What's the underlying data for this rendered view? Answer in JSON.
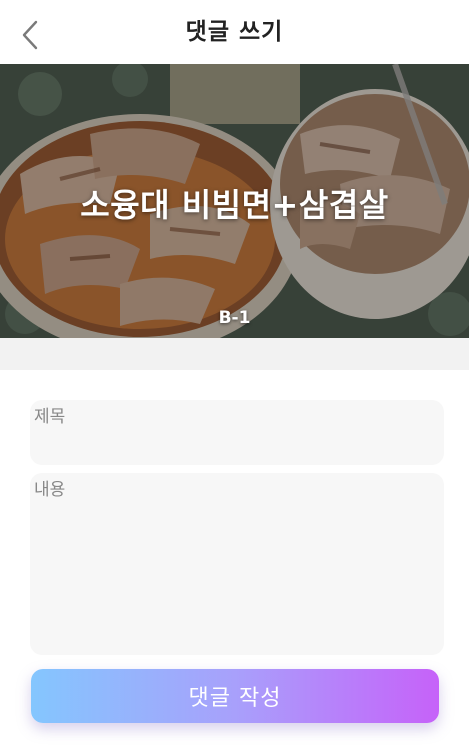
{
  "header": {
    "title": "댓글 쓰기",
    "back_icon": "chevron-left-icon"
  },
  "banner": {
    "menu_name": "소융대 비빔면+삼겹살",
    "menu_code": "B-1"
  },
  "form": {
    "title_placeholder": "제목",
    "content_placeholder": "내용",
    "title_value": "",
    "content_value": ""
  },
  "submit": {
    "label": "댓글 작성"
  },
  "colors": {
    "gradient_start": "#84c6fe",
    "gradient_end": "#c662f9",
    "field_bg": "#f7f7f7"
  }
}
